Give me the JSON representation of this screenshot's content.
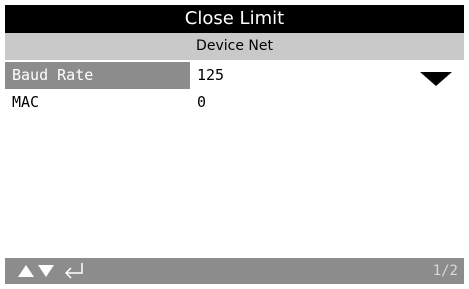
{
  "header": {
    "title": "Close Limit",
    "subtitle": "Device Net"
  },
  "settings": [
    {
      "label": "Baud Rate",
      "value": "125",
      "selected": true
    },
    {
      "label": "MAC",
      "value": "0",
      "selected": false
    }
  ],
  "footer": {
    "page": "1/2",
    "icons": [
      "up-arrow-icon",
      "down-arrow-icon",
      "enter-icon"
    ]
  },
  "colors": {
    "title_bg": "#000000",
    "subtitle_bg": "#c9c9c9",
    "selected_bg": "#8c8c8c",
    "footer_bg": "#8c8c8c"
  }
}
